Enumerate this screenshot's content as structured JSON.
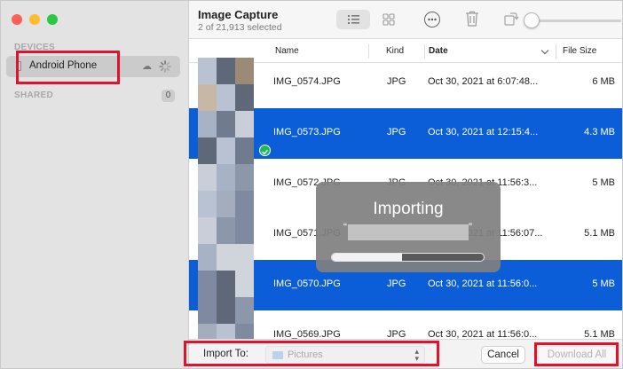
{
  "sidebar": {
    "devices_heading": "DEVICES",
    "device_name": "Android Phone",
    "shared_heading": "SHARED",
    "shared_count": "0"
  },
  "toolbar": {
    "title": "Image Capture",
    "subtitle": "2 of 21,913 selected",
    "icons": [
      "list-view-icon",
      "grid-view-icon",
      "more-icon",
      "trash-icon",
      "rotate-icon",
      "zoom-slider"
    ]
  },
  "table": {
    "columns": {
      "name": "Name",
      "kind": "Kind",
      "date": "Date",
      "size": "File Size"
    },
    "rows": [
      {
        "name": "IMG_0574.JPG",
        "kind": "JPG",
        "date": "Oct 30, 2021 at 6:07:48...",
        "size": "6 MB",
        "selected": false
      },
      {
        "name": "IMG_0573.JPG",
        "kind": "JPG",
        "date": "Oct 30, 2021 at 12:15:4...",
        "size": "4.3 MB",
        "selected": true
      },
      {
        "name": "IMG_0572.JPG",
        "kind": "JPG",
        "date": "Oct 30, 2021 at 11:56:3...",
        "size": "5 MB",
        "selected": false
      },
      {
        "name": "IMG_0571.JPG",
        "kind": "JPG",
        "date": "Oct 30, 2021 at 11:56:07...",
        "size": "5.1 MB",
        "selected": false
      },
      {
        "name": "IMG_0570.JPG",
        "kind": "JPG",
        "date": "Oct 30, 2021 at 11:56:0...",
        "size": "5 MB",
        "selected": true
      },
      {
        "name": "IMG_0569.JPG",
        "kind": "JPG",
        "date": "Oct 30, 2021 at 11:56:0...",
        "size": "5.1 MB",
        "selected": false
      }
    ]
  },
  "importing": {
    "title": "Importing",
    "quote_open": "“",
    "quote_close": "”",
    "progress": 0.46
  },
  "footer": {
    "import_to_label": "Import To:",
    "import_to_value": "Pictures",
    "cancel_label": "Cancel",
    "download_all_label": "Download All"
  },
  "colors": {
    "selection": "#0b5ed7",
    "highlight_box": "#e0132f",
    "sidebar_bg": "#e3e3e3"
  }
}
